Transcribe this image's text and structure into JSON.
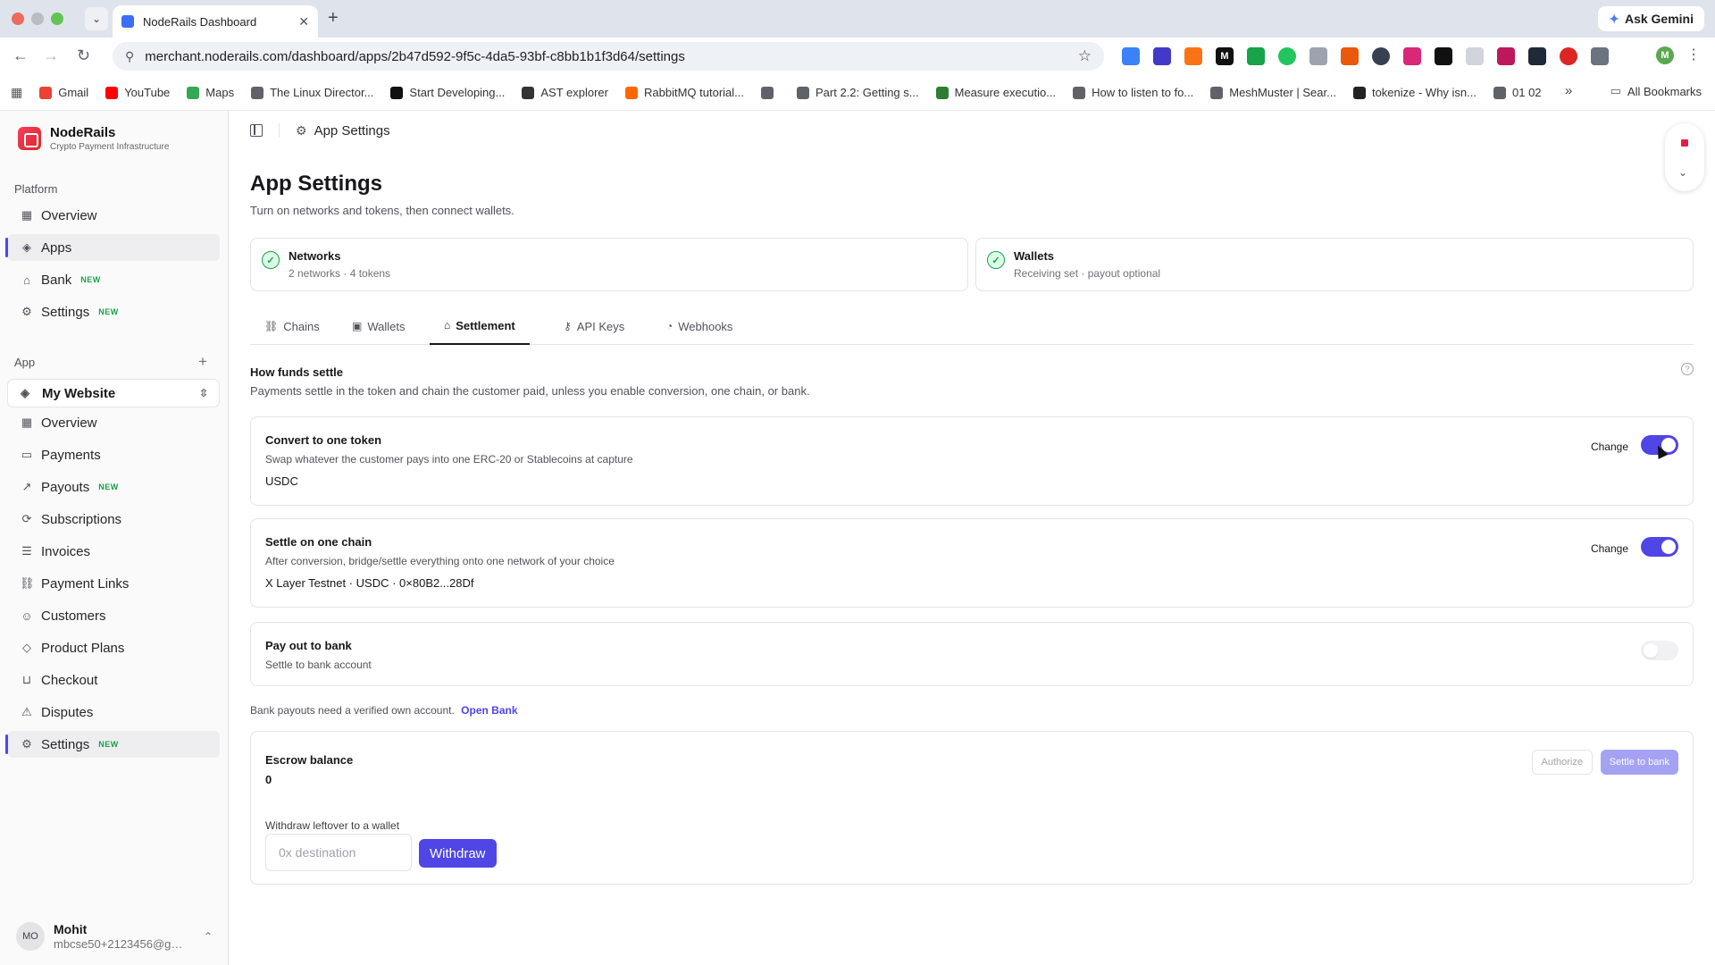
{
  "browser": {
    "tab_title": "NodeRails Dashboard",
    "url": "merchant.noderails.com/dashboard/apps/2b47d592-9f5c-4da5-93bf-c8bb1b1f3d64/settings",
    "ask_gemini": "Ask Gemini",
    "profile_initial": "M",
    "bookmarks": [
      {
        "label": "Gmail",
        "color": "#ea4335"
      },
      {
        "label": "YouTube",
        "color": "#ff0000"
      },
      {
        "label": "Maps",
        "color": "#34a853"
      },
      {
        "label": "The Linux Director...",
        "color": "#5f6368"
      },
      {
        "label": "Start Developing...",
        "color": "#111111"
      },
      {
        "label": "AST explorer",
        "color": "#333333"
      },
      {
        "label": "RabbitMQ tutorial...",
        "color": "#f60"
      },
      {
        "label": "",
        "color": "#5f6368"
      },
      {
        "label": "Part 2.2: Getting s...",
        "color": "#5f6368"
      },
      {
        "label": "Measure executio...",
        "color": "#2e7d32"
      },
      {
        "label": "How to listen to fo...",
        "color": "#5f6368"
      },
      {
        "label": "MeshMuster | Sear...",
        "color": "#5f6368"
      },
      {
        "label": "tokenize - Why isn...",
        "color": "#222222"
      },
      {
        "label": "01 02",
        "color": "#5f6368"
      }
    ],
    "all_bookmarks": "All Bookmarks",
    "more": "»"
  },
  "sidebar": {
    "brand_name": "NodeRails",
    "brand_sub": "Crypto Payment Infrastructure",
    "platform_label": "Platform",
    "platform_items": [
      {
        "label": "Overview",
        "icon": "▦",
        "badge": ""
      },
      {
        "label": "Apps",
        "icon": "◈",
        "badge": ""
      },
      {
        "label": "Bank",
        "icon": "⌂",
        "badge": "NEW"
      },
      {
        "label": "Settings",
        "icon": "⚙",
        "badge": "NEW"
      }
    ],
    "app_label": "App",
    "app_plus": "+",
    "app_selected": "My Website",
    "app_items": [
      {
        "label": "Overview",
        "icon": "▦",
        "badge": ""
      },
      {
        "label": "Payments",
        "icon": "▭",
        "badge": ""
      },
      {
        "label": "Payouts",
        "icon": "↗",
        "badge": "NEW"
      },
      {
        "label": "Subscriptions",
        "icon": "⟳",
        "badge": ""
      },
      {
        "label": "Invoices",
        "icon": "☰",
        "badge": ""
      },
      {
        "label": "Payment Links",
        "icon": "⛓",
        "badge": ""
      },
      {
        "label": "Customers",
        "icon": "☺",
        "badge": ""
      },
      {
        "label": "Product Plans",
        "icon": "◇",
        "badge": ""
      },
      {
        "label": "Checkout",
        "icon": "⊔",
        "badge": ""
      },
      {
        "label": "Disputes",
        "icon": "⚠",
        "badge": ""
      },
      {
        "label": "Settings",
        "icon": "⚙",
        "badge": "NEW"
      }
    ],
    "user_initials": "MO",
    "user_name": "Mohit",
    "user_email": "mbcse50+2123456@gm..."
  },
  "main": {
    "breadcrumb": "App Settings",
    "title": "App Settings",
    "subtitle": "Turn on networks and tokens, then connect wallets.",
    "summary": [
      {
        "title": "Networks",
        "sub": "2 networks · 4 tokens"
      },
      {
        "title": "Wallets",
        "sub": "Receiving set · payout optional"
      }
    ],
    "tabs": [
      {
        "label": "Chains",
        "icon": "⛓"
      },
      {
        "label": "Wallets",
        "icon": "▣"
      },
      {
        "label": "Settlement",
        "icon": "⌂"
      },
      {
        "label": "API Keys",
        "icon": "⚷"
      },
      {
        "label": "Webhooks",
        "icon": "◔"
      }
    ],
    "active_tab": "Settlement",
    "section_title": "How funds settle",
    "section_sub": "Payments settle in the token and chain the customer paid, unless you enable conversion, one chain, or bank.",
    "cards": {
      "convert": {
        "title": "Convert to one token",
        "sub": "Swap whatever the customer pays into one ERC-20 or Stablecoins at capture",
        "value": "USDC",
        "change": "Change",
        "enabled": true
      },
      "chain": {
        "title": "Settle on one chain",
        "sub": "After conversion, bridge/settle everything onto one network of your choice",
        "value": "X Layer Testnet · USDC · 0×80B2...28Df",
        "change": "Change",
        "enabled": true
      },
      "bank": {
        "title": "Pay out to bank",
        "sub": "Settle to bank account",
        "enabled": false
      }
    },
    "bank_note": "Bank payouts need a verified own account.",
    "bank_link": "Open Bank",
    "escrow": {
      "title": "Escrow balance",
      "value": "0",
      "authorize": "Authorize",
      "settle": "Settle to bank",
      "withdraw_label": "Withdraw leftover to a wallet",
      "withdraw_placeholder": "0x destination",
      "withdraw_button": "Withdraw"
    }
  },
  "colors": {
    "accent": "#4f46e5",
    "success": "#16a34a",
    "brand": "#dc2626"
  }
}
